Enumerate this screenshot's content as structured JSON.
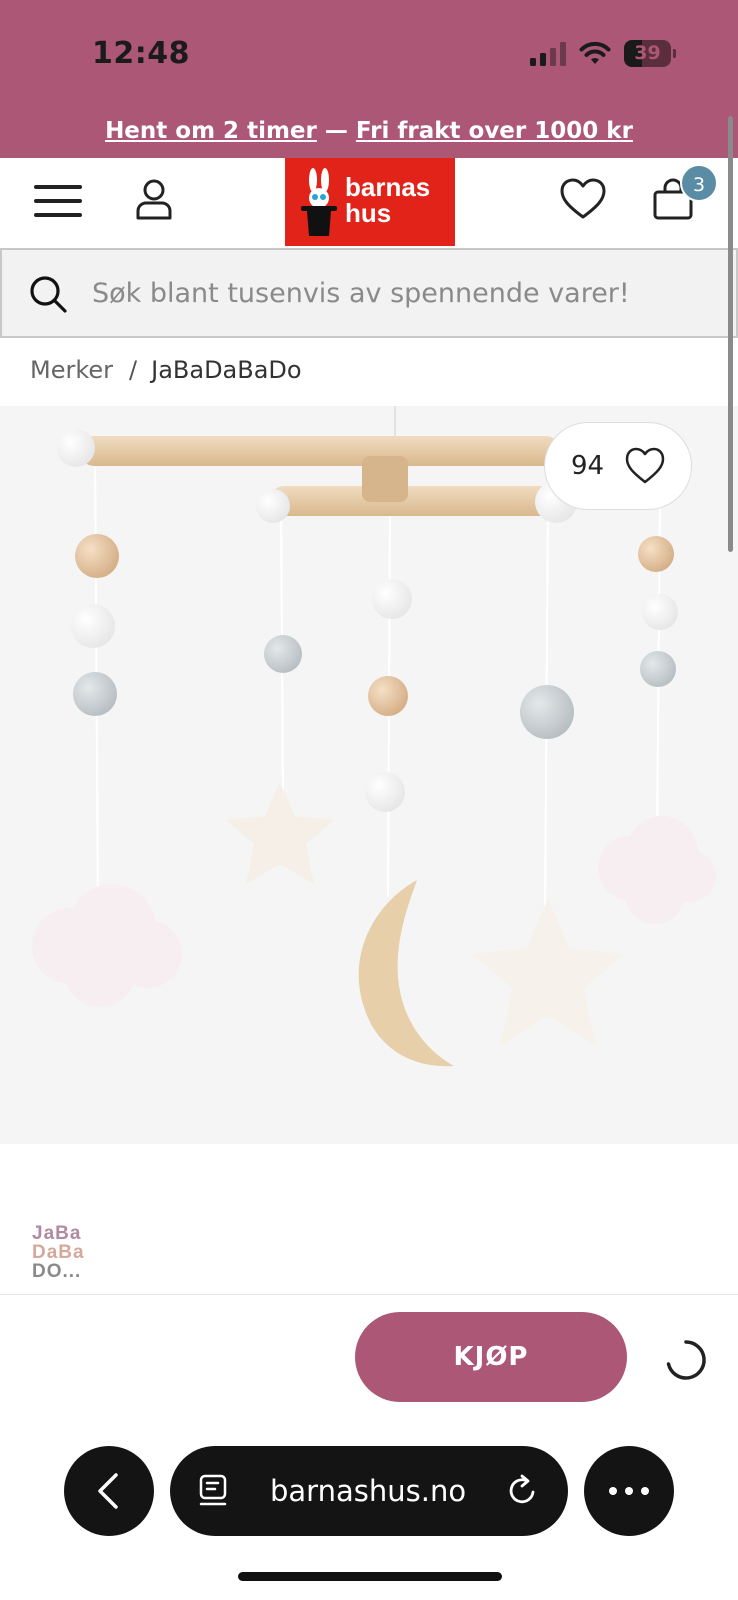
{
  "status_bar": {
    "time": "12:48",
    "battery_percent": "39",
    "battery_level": 0.39,
    "background": "#ab5775"
  },
  "promo": {
    "left_link": "Hent om 2 timer",
    "separator": " — ",
    "right_link": "Fri frakt over 1000 kr"
  },
  "header": {
    "menu_icon": "hamburger-menu-icon",
    "account_icon": "user-icon",
    "logo_line1": "barnas",
    "logo_line2": "hus",
    "wishlist_icon": "heart-icon",
    "cart_icon": "shopping-bag-icon",
    "cart_count": "3",
    "brand_color": "#e2231a",
    "badge_color": "#5b8ca6"
  },
  "search": {
    "placeholder": "Søk blant tusenvis av spennende varer!",
    "value": ""
  },
  "breadcrumb": {
    "items": [
      "Merker",
      "JaBaDaBaDo"
    ],
    "separator": "/"
  },
  "product": {
    "image_subject": "wooden baby mobile with moon, stars and clouds",
    "favorite_count": "94",
    "brand_logo_lines": [
      "JaBa",
      "DaBa",
      "DO..."
    ]
  },
  "actions": {
    "buy_label": "KJØP",
    "accent": "#ab5775"
  },
  "browser": {
    "url": "barnashus.no",
    "back_icon": "chevron-left-icon",
    "tabs_icon": "tabs-icon",
    "reload_icon": "reload-icon",
    "more_icon": "more-dots-icon"
  }
}
